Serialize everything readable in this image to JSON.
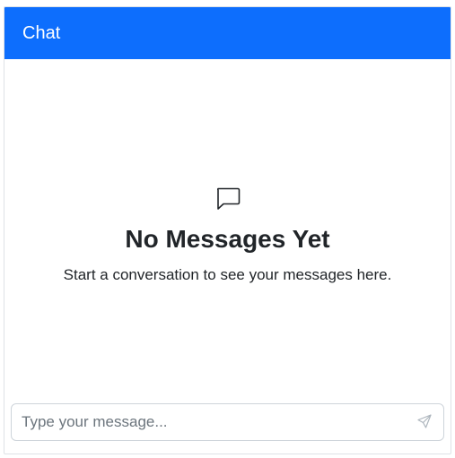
{
  "header": {
    "title": "Chat"
  },
  "empty_state": {
    "icon": "chat-bubble-icon",
    "title": "No Messages Yet",
    "subtitle": "Start a conversation to see your messages here."
  },
  "composer": {
    "placeholder": "Type your message...",
    "value": "",
    "send_icon": "send-icon"
  },
  "colors": {
    "header_bg": "#0d6efd",
    "header_text": "#ffffff",
    "text": "#212529",
    "placeholder": "#6c757d",
    "border": "#ced4da"
  }
}
